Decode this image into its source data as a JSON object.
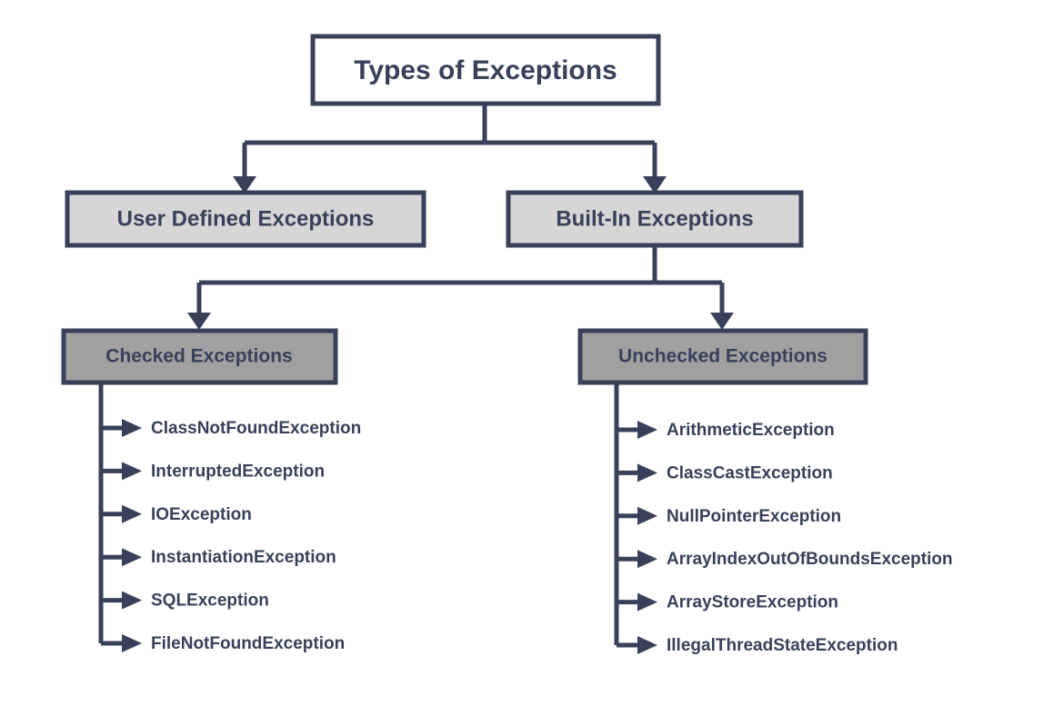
{
  "diagram": {
    "type": "hierarchy-tree",
    "title": "Types of Exceptions",
    "background_color": "#ffffff",
    "line_color": "#39415a",
    "text_color": "#39415a",
    "level_1_fill": "#ffffff",
    "level_2_fill": "#d6d6d6",
    "level_3_fill": "#a0a0a0",
    "root": {
      "label": "Types of Exceptions",
      "level": 1
    },
    "level_2": [
      {
        "label": "User Defined Exceptions",
        "level": 2
      },
      {
        "label": "Built-In Exceptions",
        "level": 2
      }
    ],
    "level_3": [
      {
        "label": "Checked Exceptions",
        "level": 3,
        "parent": "Built-In Exceptions"
      },
      {
        "label": "Unchecked Exceptions",
        "level": 3,
        "parent": "Built-In Exceptions"
      }
    ],
    "checked_exceptions": [
      "ClassNotFoundException",
      "InterruptedException",
      "IOException",
      "InstantiationException",
      "SQLException",
      "FileNotFoundException"
    ],
    "unchecked_exceptions": [
      "ArithmeticException",
      "ClassCastException",
      "NullPointerException",
      "ArrayIndexOutOfBoundsException",
      "ArrayStoreException",
      "IllegalThreadStateException"
    ]
  }
}
